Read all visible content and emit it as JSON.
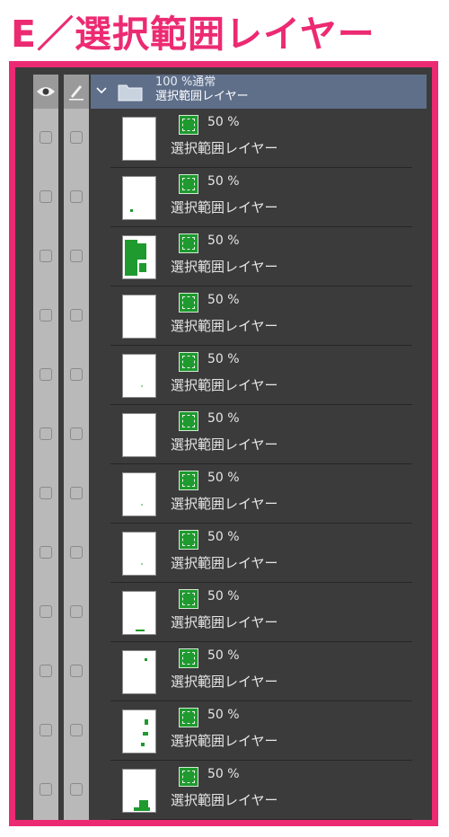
{
  "title": "E／選択範囲レイヤー",
  "folder": {
    "opacity_mode": "100 %通常",
    "name": "選択範囲レイヤー"
  },
  "layers": [
    {
      "opacity": "50 %",
      "name": "選択範囲レイヤー",
      "thumb": "blank"
    },
    {
      "opacity": "50 %",
      "name": "選択範囲レイヤー",
      "thumb": "dot"
    },
    {
      "opacity": "50 %",
      "name": "選択範囲レイヤー",
      "thumb": "heavy"
    },
    {
      "opacity": "50 %",
      "name": "選択範囲レイヤー",
      "thumb": "blank"
    },
    {
      "opacity": "50 %",
      "name": "選択範囲レイヤー",
      "thumb": "faint"
    },
    {
      "opacity": "50 %",
      "name": "選択範囲レイヤー",
      "thumb": "blank"
    },
    {
      "opacity": "50 %",
      "name": "選択範囲レイヤー",
      "thumb": "faint"
    },
    {
      "opacity": "50 %",
      "name": "選択範囲レイヤー",
      "thumb": "faint"
    },
    {
      "opacity": "50 %",
      "name": "選択範囲レイヤー",
      "thumb": "bottom-dots"
    },
    {
      "opacity": "50 %",
      "name": "選択範囲レイヤー",
      "thumb": "dot-top"
    },
    {
      "opacity": "50 %",
      "name": "選択範囲レイヤー",
      "thumb": "scatter"
    },
    {
      "opacity": "50 %",
      "name": "選択範囲レイヤー",
      "thumb": "bottom-block"
    }
  ],
  "colors": {
    "accent": "#ec2a72",
    "selection_green": "#1e9a2e",
    "panel_bg": "#3b3b3b",
    "folder_header": "#5f6f8a"
  },
  "icons": {
    "eye_column": "eye-icon",
    "edit_column": "pen-icon",
    "folder_toggle": "chevron-down-icon",
    "folder": "folder-icon",
    "layer_color": "selection-color-swatch-icon"
  }
}
